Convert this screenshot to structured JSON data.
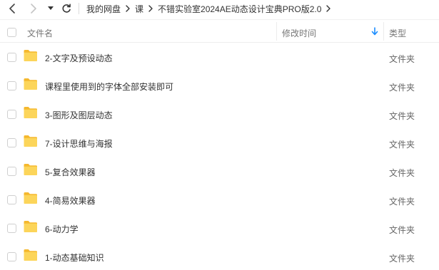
{
  "toolbar": {
    "back_icon": "chevron-left-icon",
    "forward_icon": "chevron-right-icon",
    "dropdown_icon": "caret-down-icon",
    "refresh_icon": "refresh-icon"
  },
  "breadcrumb": [
    "我的网盘",
    "课",
    "不错实验室2024AE动态设计宝典PRO版2.0"
  ],
  "columns": {
    "name": "文件名",
    "modified": "修改时间",
    "type": "类型",
    "sort_icon": "sort-down-arrow-icon"
  },
  "files": [
    {
      "name": "2-文字及预设动态",
      "type": "文件夹"
    },
    {
      "name": "课程里使用到的字体全部安装即可",
      "type": "文件夹"
    },
    {
      "name": "3-图形及图层动态",
      "type": "文件夹"
    },
    {
      "name": "7-设计思维与海报",
      "type": "文件夹"
    },
    {
      "name": "5-复合效果器",
      "type": "文件夹"
    },
    {
      "name": "4-简易效果器",
      "type": "文件夹"
    },
    {
      "name": "6-动力学",
      "type": "文件夹"
    },
    {
      "name": "1-动态基础知识",
      "type": "文件夹"
    }
  ],
  "colors": {
    "folder": "#f9c94a",
    "sort_accent": "#1a8cff"
  }
}
